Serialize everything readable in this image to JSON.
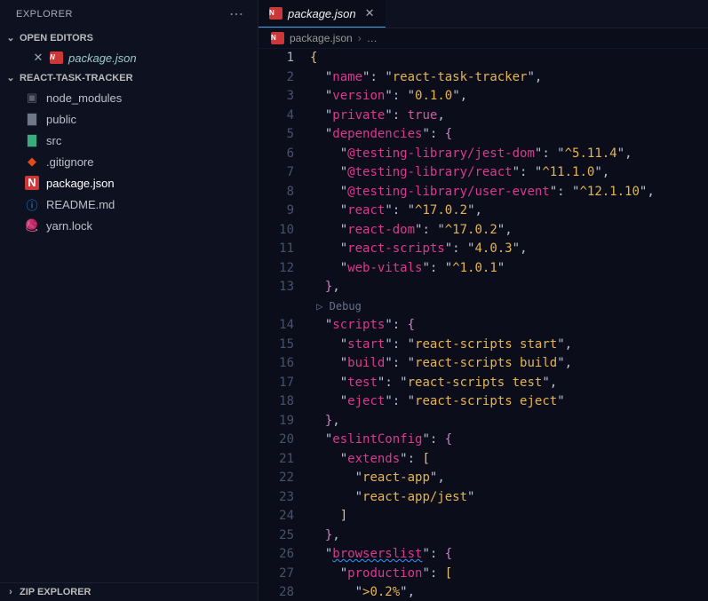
{
  "sidebar": {
    "title": "EXPLORER",
    "sections": {
      "openEditors": {
        "label": "OPEN EDITORS",
        "items": [
          {
            "label": "package.json"
          }
        ]
      },
      "project": {
        "label": "REACT-TASK-TRACKER",
        "files": [
          {
            "label": "node_modules",
            "icon": "module-folder"
          },
          {
            "label": "public",
            "icon": "folder"
          },
          {
            "label": "src",
            "icon": "vue-folder"
          },
          {
            "label": ".gitignore",
            "icon": "git"
          },
          {
            "label": "package.json",
            "icon": "npm",
            "active": true
          },
          {
            "label": "README.md",
            "icon": "info"
          },
          {
            "label": "yarn.lock",
            "icon": "yarn"
          }
        ]
      },
      "zip": {
        "label": "ZIP EXPLORER"
      }
    }
  },
  "tabs": [
    {
      "label": "package.json"
    }
  ],
  "breadcrumb": {
    "file": "package.json",
    "more": "…"
  },
  "debugLabel": "Debug",
  "code": {
    "lines": [
      {
        "n": 1,
        "t": "{",
        "cls": "br",
        "cur": true
      },
      {
        "n": 2,
        "t": "  \"name\": \"react-task-tracker\",",
        "kv": [
          "name",
          "react-task-tracker"
        ],
        "c": true
      },
      {
        "n": 3,
        "t": "  \"version\": \"0.1.0\",",
        "kv": [
          "version",
          "0.1.0"
        ],
        "c": true
      },
      {
        "n": 4,
        "t": "  \"private\": true,",
        "kb": [
          "private",
          "true"
        ],
        "c": true
      },
      {
        "n": 5,
        "t": "  \"dependencies\": {",
        "ko": [
          "dependencies"
        ]
      },
      {
        "n": 6,
        "t": "    \"@testing-library/jest-dom\": \"^5.11.4\",",
        "kv": [
          "@testing-library/jest-dom",
          "^5.11.4"
        ],
        "c": true
      },
      {
        "n": 7,
        "t": "    \"@testing-library/react\": \"^11.1.0\",",
        "kv": [
          "@testing-library/react",
          "^11.1.0"
        ],
        "c": true
      },
      {
        "n": 8,
        "t": "    \"@testing-library/user-event\": \"^12.1.10\",",
        "kv": [
          "@testing-library/user-event",
          "^12.1.10"
        ],
        "c": true
      },
      {
        "n": 9,
        "t": "    \"react\": \"^17.0.2\",",
        "kv": [
          "react",
          "^17.0.2"
        ],
        "c": true
      },
      {
        "n": 10,
        "t": "    \"react-dom\": \"^17.0.2\",",
        "kv": [
          "react-dom",
          "^17.0.2"
        ],
        "c": true
      },
      {
        "n": 11,
        "t": "    \"react-scripts\": \"4.0.3\",",
        "kv": [
          "react-scripts",
          "4.0.3"
        ],
        "c": true
      },
      {
        "n": 12,
        "t": "    \"web-vitals\": \"^1.0.1\"",
        "kv": [
          "web-vitals",
          "^1.0.1"
        ]
      },
      {
        "n": 13,
        "t": "  },",
        "close": "},"
      },
      {
        "dbg": true
      },
      {
        "n": 14,
        "t": "  \"scripts\": {",
        "ko": [
          "scripts"
        ]
      },
      {
        "n": 15,
        "t": "    \"start\": \"react-scripts start\",",
        "kv": [
          "start",
          "react-scripts start"
        ],
        "c": true
      },
      {
        "n": 16,
        "t": "    \"build\": \"react-scripts build\",",
        "kv": [
          "build",
          "react-scripts build"
        ],
        "c": true
      },
      {
        "n": 17,
        "t": "    \"test\": \"react-scripts test\",",
        "kv": [
          "test",
          "react-scripts test"
        ],
        "c": true
      },
      {
        "n": 18,
        "t": "    \"eject\": \"react-scripts eject\"",
        "kv": [
          "eject",
          "react-scripts eject"
        ]
      },
      {
        "n": 19,
        "t": "  },",
        "close": "},"
      },
      {
        "n": 20,
        "t": "  \"eslintConfig\": {",
        "ko": [
          "eslintConfig"
        ]
      },
      {
        "n": 21,
        "t": "    \"extends\": [",
        "ka": [
          "extends"
        ]
      },
      {
        "n": 22,
        "t": "      \"react-app\",",
        "sv": "react-app",
        "c": true
      },
      {
        "n": 23,
        "t": "      \"react-app/jest\"",
        "sv": "react-app/jest"
      },
      {
        "n": 24,
        "t": "    ]",
        "closeArr": "]"
      },
      {
        "n": 25,
        "t": "  },",
        "close": "},"
      },
      {
        "n": 26,
        "t": "  \"browserslist\": {",
        "ko": [
          "browserslist"
        ],
        "wav": true
      },
      {
        "n": 27,
        "t": "    \"production\": [",
        "ka": [
          "production"
        ]
      },
      {
        "n": 28,
        "t": "      \">0.2%\",",
        "sv": ">0.2%",
        "c": true
      }
    ]
  }
}
